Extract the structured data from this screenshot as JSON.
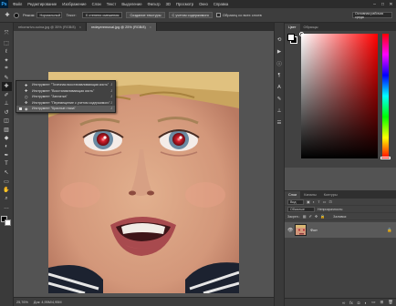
{
  "menubar": {
    "logo": "Ps",
    "items": [
      "Файл",
      "Редактирование",
      "Изображение",
      "Слои",
      "Текст",
      "Выделение",
      "Фильтр",
      "3D",
      "Просмотр",
      "Окно",
      "Справка"
    ],
    "window_controls": [
      "–",
      "□",
      "✕"
    ]
  },
  "options": {
    "mode_label": "Режим:",
    "mode_value": "Нормальный",
    "source_label": "Текст:",
    "source_value": "Х степени смешения",
    "texture_button": "Создание текстуры",
    "content_button": "С учетом содержимого",
    "sample_all_label": "Образец со всех слоев",
    "workspace": "Основная рабочая среда"
  },
  "tools": [
    {
      "icon": "⤧",
      "name": "move-tool"
    },
    {
      "icon": "⬚",
      "name": "marquee-tool"
    },
    {
      "icon": "ℓ",
      "name": "lasso-tool"
    },
    {
      "icon": "✦",
      "name": "quick-selection-tool"
    },
    {
      "icon": "⌗",
      "name": "crop-tool"
    },
    {
      "icon": "✎",
      "name": "eyedropper-tool"
    },
    {
      "icon": "✚",
      "name": "healing-brush-tool"
    },
    {
      "icon": "✐",
      "name": "brush-tool"
    },
    {
      "icon": "⊥",
      "name": "clone-stamp-tool"
    },
    {
      "icon": "↺",
      "name": "history-brush-tool"
    },
    {
      "icon": "◫",
      "name": "eraser-tool"
    },
    {
      "icon": "▥",
      "name": "gradient-tool"
    },
    {
      "icon": "◆",
      "name": "blur-tool"
    },
    {
      "icon": "◐",
      "name": "dodge-tool"
    },
    {
      "icon": "✒",
      "name": "pen-tool"
    },
    {
      "icon": "T",
      "name": "type-tool"
    },
    {
      "icon": "↖",
      "name": "path-selection-tool"
    },
    {
      "icon": "▭",
      "name": "rectangle-tool"
    },
    {
      "icon": "✋",
      "name": "hand-tool"
    },
    {
      "icon": "⌕",
      "name": "zoom-tool"
    },
    {
      "icon": "…",
      "name": "extra-tools"
    }
  ],
  "tabs": [
    {
      "label": "rekonsrtvo-soina.jpg @ 35% (RGB/8)",
      "close": "×"
    },
    {
      "label": "redeyeremoval.jpg @ 25% (RGB/8)",
      "close": "×"
    }
  ],
  "flyout": {
    "items": [
      {
        "label": "Инструмент \"Точечная восстанавливающая кисть\"",
        "key": "J"
      },
      {
        "label": "Инструмент \"Восстанавливающая кисть\"",
        "key": "J"
      },
      {
        "label": "Инструмент \"Заплатка\"",
        "key": "J"
      },
      {
        "label": "Инструмент \"Перемещение с учетом содержимого\"",
        "key": "J"
      },
      {
        "label": "Инструмент \"Красные глаза\"",
        "key": "J"
      }
    ]
  },
  "status": {
    "zoom": "25,76%",
    "doc": "Док: 4,95M/4,95M"
  },
  "panels": {
    "color_tabs": [
      "Цвет",
      "Образцы"
    ],
    "layers_tabs": [
      "Слои",
      "Каналы",
      "Контуры"
    ],
    "kind_label": "Вид",
    "blend_mode": "Обычные",
    "opacity_label": "Непрозрачность:",
    "lock_label": "Закреп.:",
    "fill_label": "Заливка:",
    "layer_name": "Фон"
  },
  "colors": {
    "foreground": "#ffffff",
    "background": "#000000",
    "hue": "#ff0000"
  }
}
